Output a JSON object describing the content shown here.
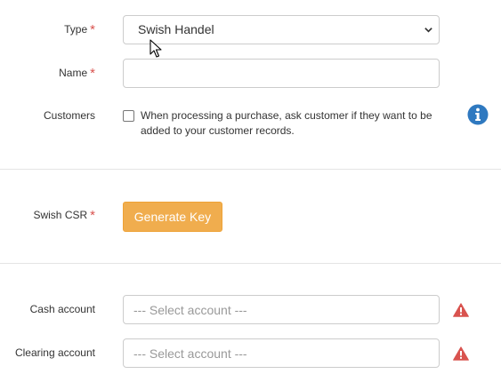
{
  "form": {
    "type": {
      "label": "Type",
      "required_mark": "*",
      "value": "Swish Handel"
    },
    "name": {
      "label": "Name",
      "required_mark": "*",
      "value": ""
    },
    "customers": {
      "label": "Customers",
      "checkbox_checked": false,
      "checkbox_text": "When processing a purchase, ask customer if they want to be added to your customer records.",
      "info_icon": "info-circle-icon"
    },
    "swish_csr": {
      "label": "Swish CSR",
      "required_mark": "*",
      "button_label": "Generate Key"
    },
    "cash_account": {
      "label": "Cash account",
      "placeholder": "--- Select account ---",
      "warning_icon": "warning-triangle-icon"
    },
    "clearing_account": {
      "label": "Clearing account",
      "placeholder": "--- Select account ---",
      "warning_icon": "warning-triangle-icon"
    }
  },
  "colors": {
    "required": "#d9534f",
    "button_bg": "#f0ad4e",
    "info_icon": "#2f79c0",
    "warning_icon": "#d9534f"
  }
}
